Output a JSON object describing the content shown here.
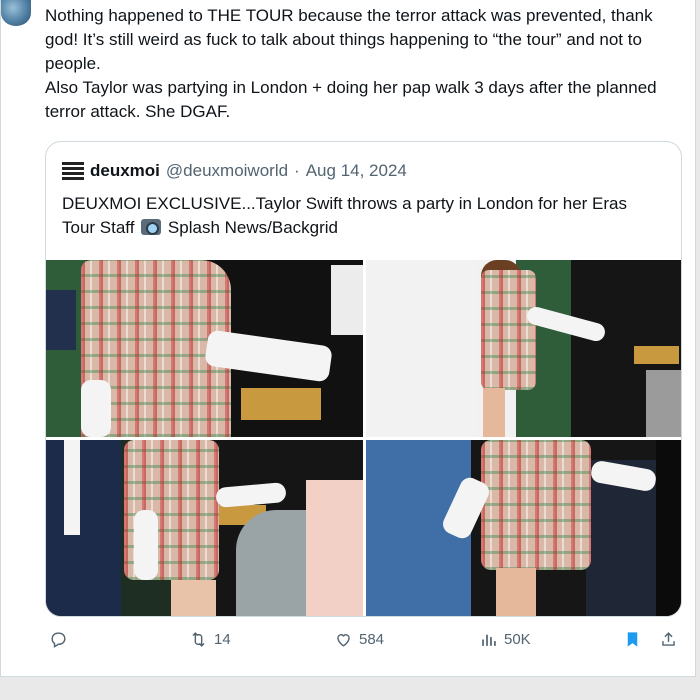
{
  "tweet": {
    "text_lines": [
      "Nothing happened to THE TOUR because the terror attack was prevented, thank god! It’s still weird as fuck to talk about things happening to “the tour” and not to people.",
      "Also Taylor was partying in London + doing her pap walk 3 days after the planned terror attack. She DGAF."
    ]
  },
  "quoted": {
    "name": "deuxmoi",
    "handle": "@deuxmoiworld",
    "separator": "·",
    "date": "Aug 14, 2024",
    "text_before_icon": "DEUXMOI EXCLUSIVE...Taylor Swift throws a party in London for her Eras Tour Staff",
    "text_after_icon": "Splash News/Backgrid"
  },
  "actions": {
    "reply_count": "",
    "retweet_count": "14",
    "like_count": "584",
    "views_count": "50K"
  },
  "colors": {
    "accent": "#1d9bf0",
    "muted": "#536471",
    "border": "#cfd9de"
  },
  "icons": [
    "reply-icon",
    "retweet-icon",
    "like-icon",
    "views-icon",
    "bookmark-icon",
    "share-icon",
    "camera-icon"
  ]
}
